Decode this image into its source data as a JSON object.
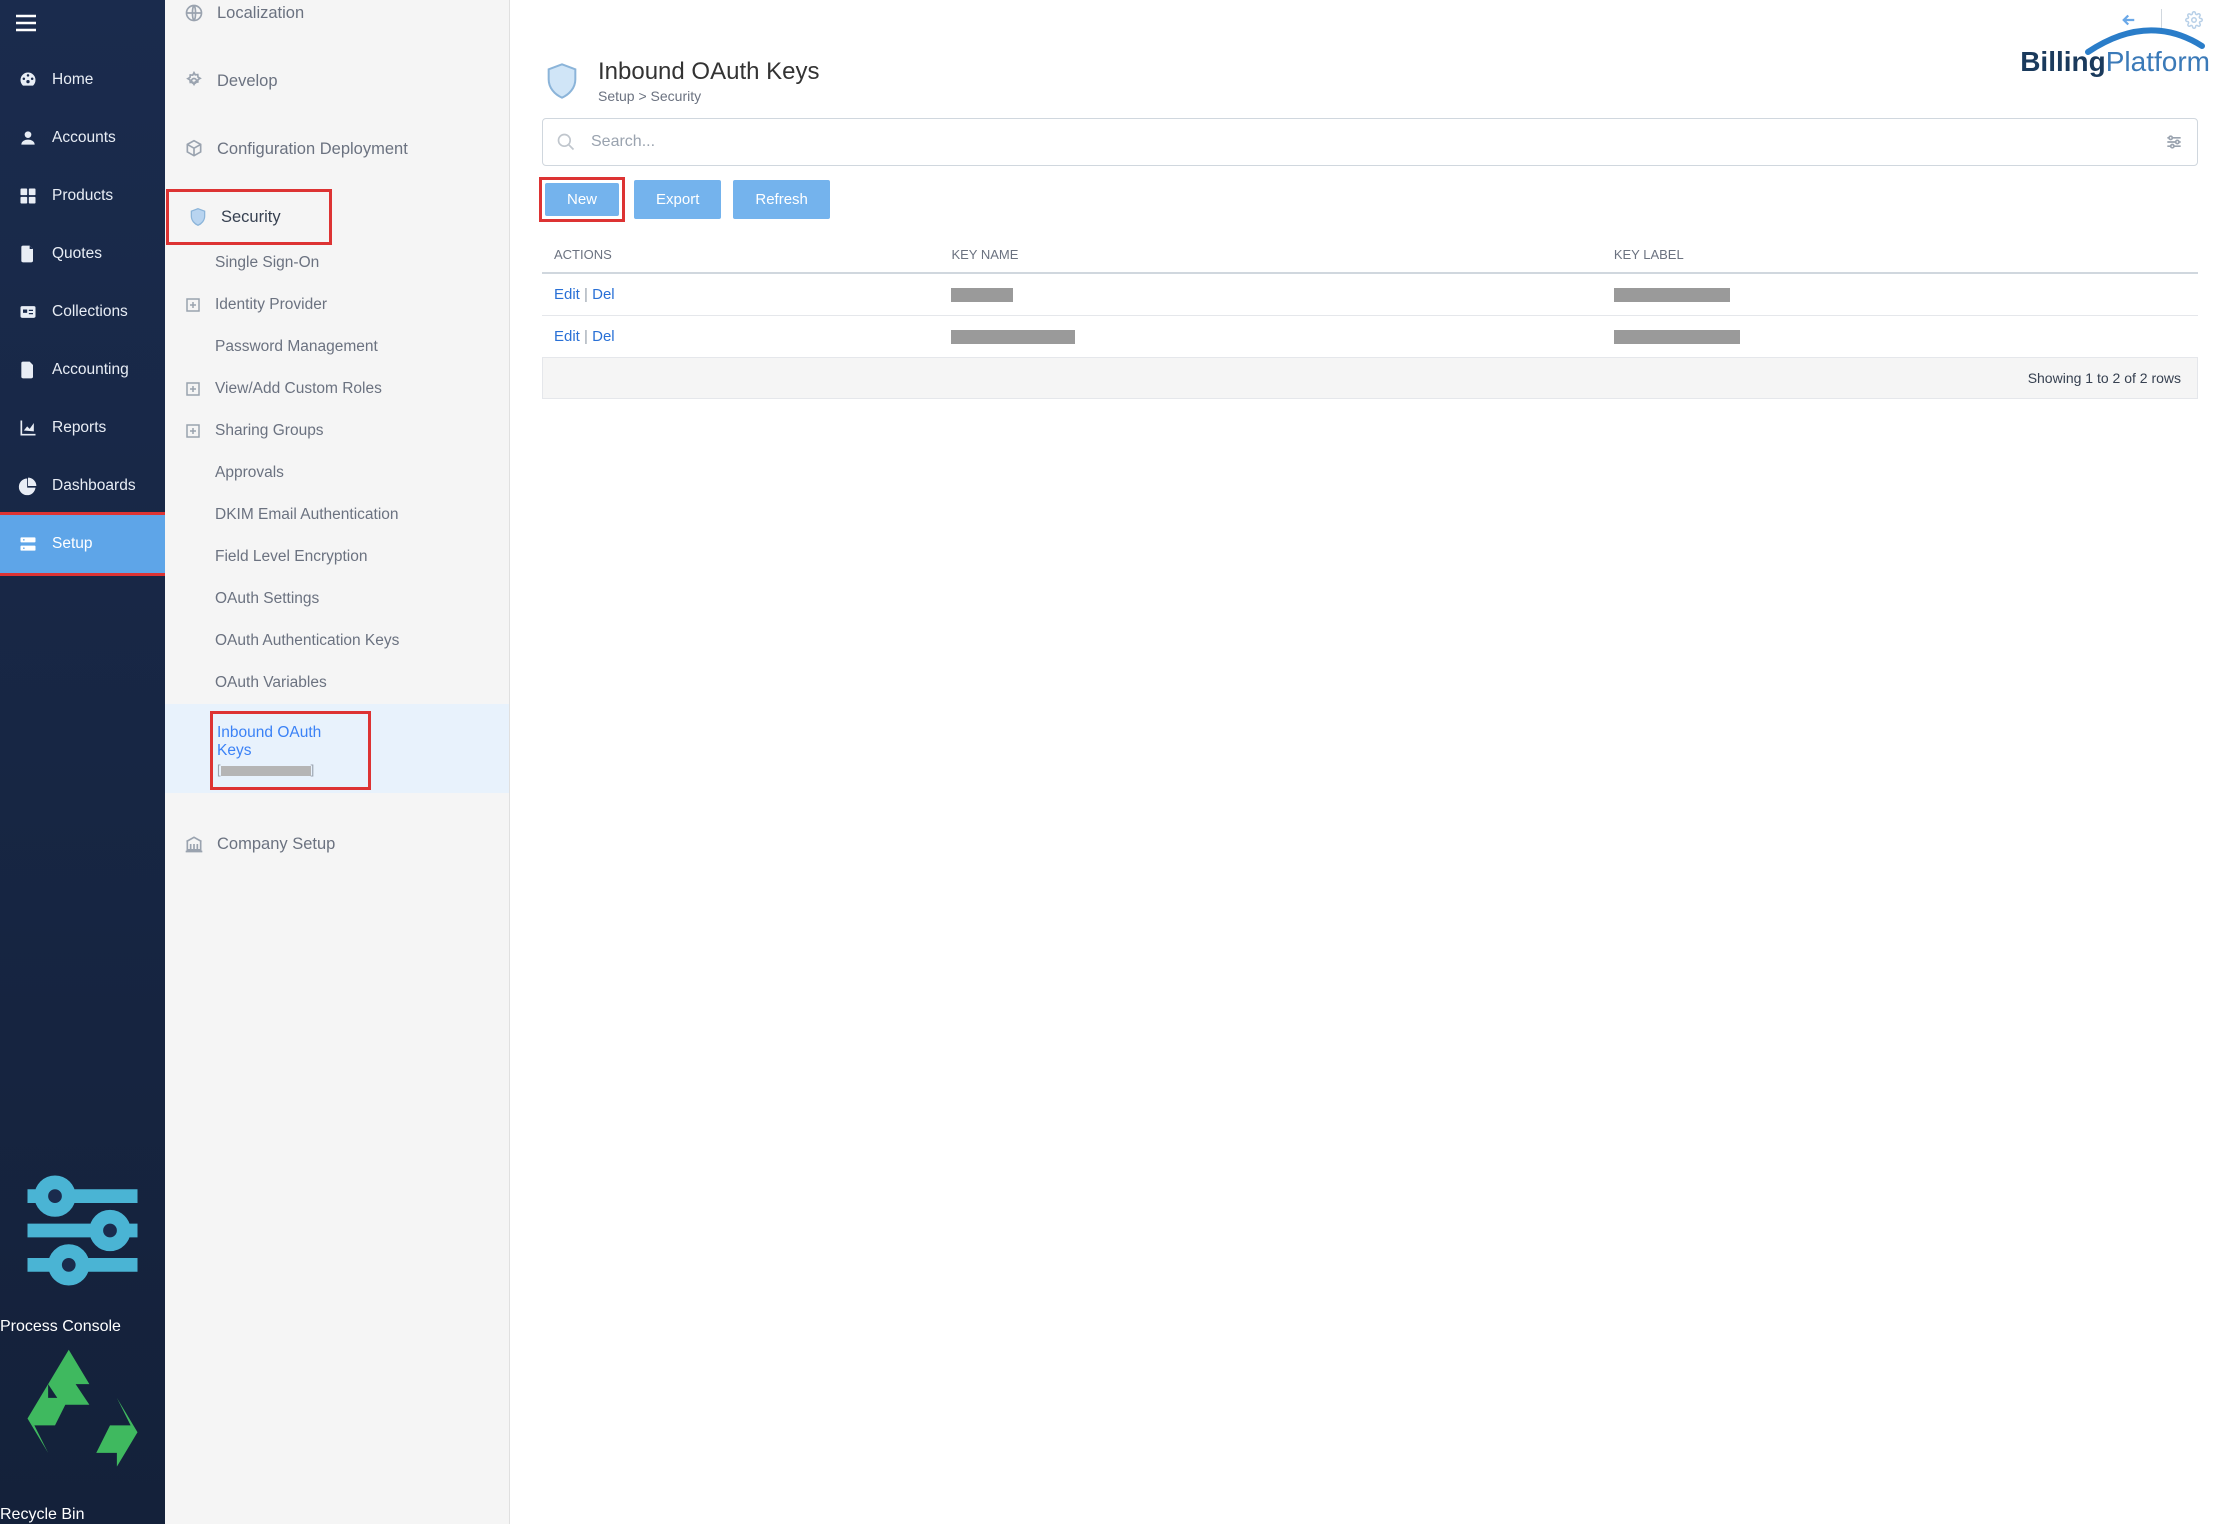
{
  "sidebar": {
    "items": [
      {
        "label": "Home",
        "icon": "gauge"
      },
      {
        "label": "Accounts",
        "icon": "user"
      },
      {
        "label": "Products",
        "icon": "grid"
      },
      {
        "label": "Quotes",
        "icon": "doc"
      },
      {
        "label": "Collections",
        "icon": "idcard"
      },
      {
        "label": "Accounting",
        "icon": "file"
      },
      {
        "label": "Reports",
        "icon": "chart"
      },
      {
        "label": "Dashboards",
        "icon": "pie"
      },
      {
        "label": "Setup",
        "icon": "server",
        "active": true
      }
    ],
    "footer": [
      {
        "label": "Process Console",
        "icon": "sliders"
      },
      {
        "label": "Recycle Bin",
        "icon": "recycle"
      }
    ]
  },
  "secondary": {
    "localization": "Localization",
    "develop": "Develop",
    "config_deploy": "Configuration Deployment",
    "security": "Security",
    "security_items": [
      {
        "label": "Single Sign-On"
      },
      {
        "label": "Identity Provider",
        "expandable": true
      },
      {
        "label": "Password Management"
      },
      {
        "label": "View/Add Custom Roles",
        "expandable": true
      },
      {
        "label": "Sharing Groups",
        "expandable": true
      },
      {
        "label": "Approvals"
      },
      {
        "label": "DKIM Email Authentication"
      },
      {
        "label": "Field Level Encryption"
      },
      {
        "label": "OAuth Settings"
      },
      {
        "label": "OAuth Authentication Keys"
      },
      {
        "label": "OAuth Variables"
      },
      {
        "label": "Inbound OAuth Keys",
        "active": true
      }
    ],
    "company_setup": "Company Setup"
  },
  "page": {
    "title": "Inbound OAuth Keys",
    "breadcrumb": "Setup > Security"
  },
  "search": {
    "placeholder": "Search..."
  },
  "buttons": {
    "new": "New",
    "export": "Export",
    "refresh": "Refresh"
  },
  "table": {
    "headers": [
      "ACTIONS",
      "KEY NAME",
      "KEY LABEL"
    ],
    "rows": [
      {
        "edit": "Edit",
        "del": "Del",
        "name_w": 62,
        "label_w": 116
      },
      {
        "edit": "Edit",
        "del": "Del",
        "name_w": 124,
        "label_w": 126
      }
    ],
    "footer": "Showing 1 to 2 of 2 rows"
  },
  "logo": {
    "text1": "Billing",
    "text2": "Platform"
  }
}
